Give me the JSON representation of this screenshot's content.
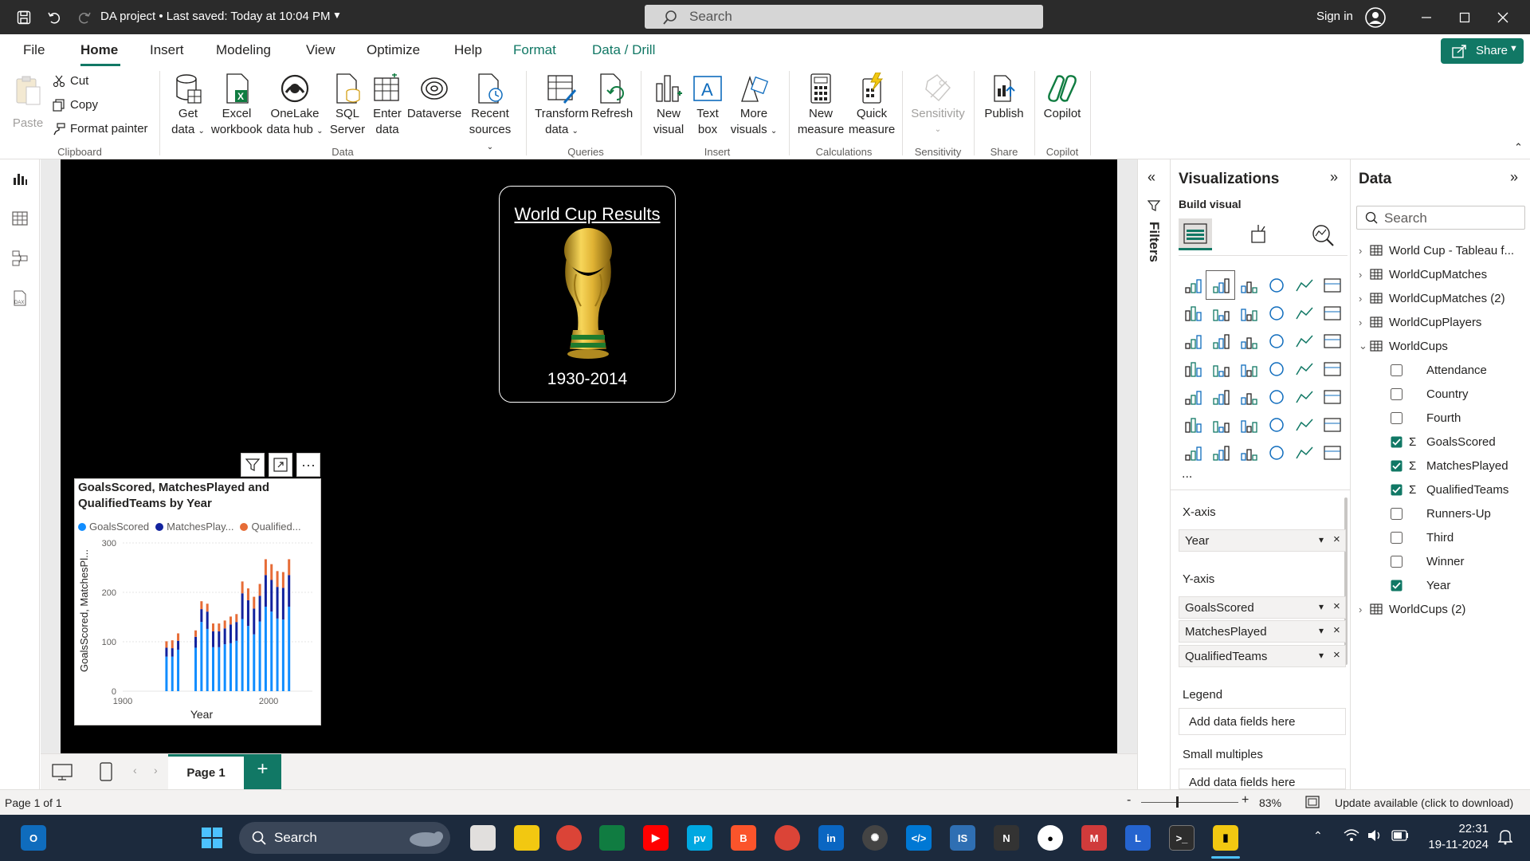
{
  "titlebar": {
    "doc_title": "DA project • Last saved: Today at 10:04 PM",
    "search_placeholder": "Search",
    "signin": "Sign in"
  },
  "menu": {
    "tabs": [
      "File",
      "Home",
      "Insert",
      "Modeling",
      "View",
      "Optimize",
      "Help",
      "Format",
      "Data / Drill"
    ],
    "share": "Share"
  },
  "ribbon": {
    "clipboard": {
      "paste": "Paste",
      "cut": "Cut",
      "copy": "Copy",
      "format_painter": "Format painter",
      "group": "Clipboard"
    },
    "data": {
      "get_data": [
        "Get",
        "data"
      ],
      "excel": [
        "Excel",
        "workbook"
      ],
      "onelake": [
        "OneLake",
        "data hub"
      ],
      "sql": [
        "SQL",
        "Server"
      ],
      "enter": [
        "Enter",
        "data"
      ],
      "dataverse": [
        "Dataverse"
      ],
      "recent": [
        "Recent",
        "sources"
      ],
      "group": "Data"
    },
    "queries": {
      "transform": [
        "Transform",
        "data"
      ],
      "refresh": [
        "Refresh"
      ],
      "group": "Queries"
    },
    "insert": {
      "new_visual": [
        "New",
        "visual"
      ],
      "text_box": [
        "Text",
        "box"
      ],
      "more_visuals": [
        "More",
        "visuals"
      ],
      "group": "Insert"
    },
    "calculations": {
      "new_measure": [
        "New",
        "measure"
      ],
      "quick_measure": [
        "Quick",
        "measure"
      ],
      "group": "Calculations"
    },
    "sensitivity": {
      "label": [
        "Sensitivity"
      ],
      "group": "Sensitivity"
    },
    "share": {
      "publish": [
        "Publish"
      ],
      "group": "Share"
    },
    "copilot": {
      "label": [
        "Copilot"
      ],
      "group": "Copilot"
    }
  },
  "card": {
    "title": "World Cup Results",
    "years": "1930-2014"
  },
  "visual": {
    "title": "GoalsScored, MatchesPlayed and QualifiedTeams by Year",
    "legend": [
      "GoalsScored",
      "MatchesPlay...",
      "Qualified..."
    ],
    "ylabel": "GoalsScored, MatchesPl...",
    "xlabel": "Year",
    "colors": {
      "goals": "#118dff",
      "matches": "#12239e",
      "qualified": "#e66c37"
    }
  },
  "chart_data": {
    "type": "bar",
    "stacked": true,
    "xlabel": "Year",
    "ylabel": "GoalsScored, MatchesPl...",
    "ylim": [
      0,
      300
    ],
    "xlim": [
      1900,
      2030
    ],
    "yticks": [
      0,
      100,
      200,
      300
    ],
    "xticks": [
      1900,
      2000
    ],
    "legend_position": "top-left",
    "x": [
      1930,
      1934,
      1938,
      1950,
      1954,
      1958,
      1962,
      1966,
      1970,
      1974,
      1978,
      1982,
      1986,
      1990,
      1994,
      1998,
      2002,
      2006,
      2010,
      2014
    ],
    "series": [
      {
        "name": "GoalsScored",
        "values": [
          70,
          70,
          84,
          88,
          140,
          126,
          89,
          89,
          95,
          97,
          102,
          146,
          132,
          115,
          141,
          171,
          161,
          147,
          145,
          171
        ]
      },
      {
        "name": "MatchesPlayed",
        "values": [
          18,
          17,
          18,
          22,
          26,
          35,
          32,
          32,
          32,
          38,
          38,
          52,
          52,
          52,
          52,
          64,
          64,
          64,
          64,
          64
        ]
      },
      {
        "name": "QualifiedTeams",
        "values": [
          13,
          16,
          15,
          13,
          16,
          16,
          16,
          16,
          16,
          16,
          16,
          24,
          24,
          24,
          24,
          32,
          32,
          32,
          32,
          32
        ]
      }
    ]
  },
  "pagebar": {
    "page_tab": "Page 1",
    "add": "+"
  },
  "filters": {
    "label": "Filters"
  },
  "viz_pane": {
    "title": "Visualizations",
    "build_visual": "Build visual",
    "more": "...",
    "xaxis_label": "X-axis",
    "xaxis_fields": [
      "Year"
    ],
    "yaxis_label": "Y-axis",
    "yaxis_fields": [
      "GoalsScored",
      "MatchesPlayed",
      "QualifiedTeams"
    ],
    "legend_label": "Legend",
    "legend_placeholder": "Add data fields here",
    "small_multiples_label": "Small multiples",
    "small_multiples_placeholder": "Add data fields here"
  },
  "data_pane": {
    "title": "Data",
    "search_placeholder": "Search",
    "tables": [
      "World Cup - Tableau f...",
      "WorldCupMatches",
      "WorldCupMatches (2)",
      "WorldCupPlayers"
    ],
    "expanded_table": "WorldCups",
    "fields": [
      {
        "name": "Attendance",
        "checked": false,
        "sigma": false
      },
      {
        "name": "Country",
        "checked": false,
        "sigma": false
      },
      {
        "name": "Fourth",
        "checked": false,
        "sigma": false
      },
      {
        "name": "GoalsScored",
        "checked": true,
        "sigma": true
      },
      {
        "name": "MatchesPlayed",
        "checked": true,
        "sigma": true
      },
      {
        "name": "QualifiedTeams",
        "checked": true,
        "sigma": true
      },
      {
        "name": "Runners-Up",
        "checked": false,
        "sigma": false
      },
      {
        "name": "Third",
        "checked": false,
        "sigma": false
      },
      {
        "name": "Winner",
        "checked": false,
        "sigma": false
      },
      {
        "name": "Year",
        "checked": true,
        "sigma": false
      }
    ],
    "last_table": "WorldCups (2)"
  },
  "statusbar": {
    "page_info": "Page 1 of 1",
    "zoom": "83%",
    "update": "Update available (click to download)"
  },
  "taskbar": {
    "search": "Search",
    "time": "22:31",
    "date": "19-11-2024"
  },
  "icons": {
    "save": "save-icon",
    "undo": "undo-icon",
    "redo": "redo-icon",
    "search": "search-icon",
    "user": "user-icon",
    "minimize": "minimize-icon",
    "maximize": "maximize-icon",
    "close": "close-icon",
    "filter": "filter-icon",
    "focus": "focus-mode-icon",
    "more": "more-options-icon",
    "table": "table-icon",
    "chevron": "chevron-icon"
  }
}
